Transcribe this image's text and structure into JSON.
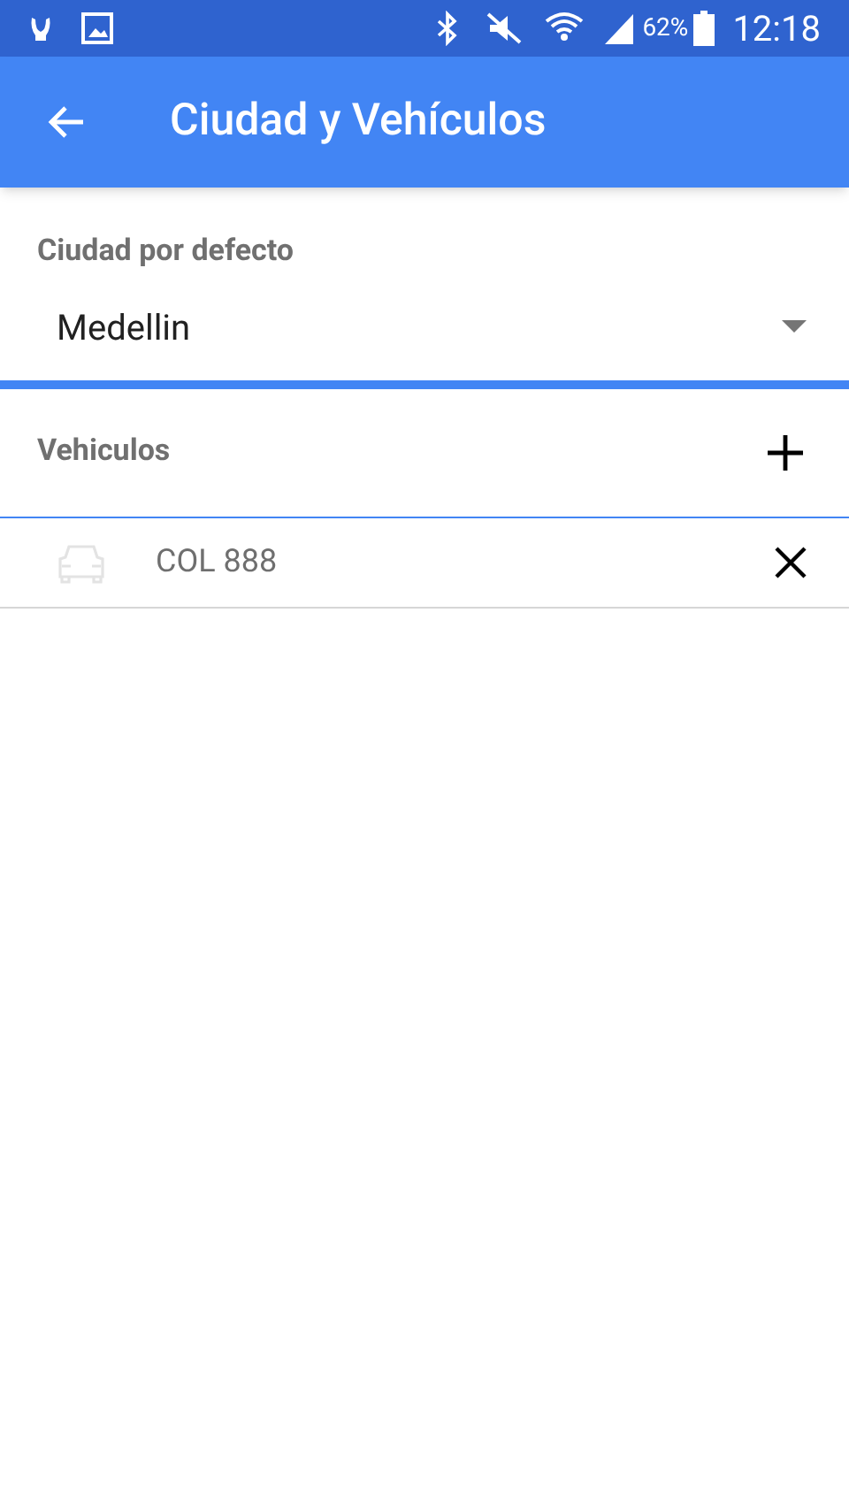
{
  "status_bar": {
    "battery_percent": "62%",
    "time": "12:18"
  },
  "app_bar": {
    "title": "Ciudad y Vehículos"
  },
  "city": {
    "label": "Ciudad por defecto",
    "value": "Medellin"
  },
  "vehicles": {
    "label": "Vehiculos",
    "items": [
      {
        "plate": "COL 888"
      }
    ]
  }
}
